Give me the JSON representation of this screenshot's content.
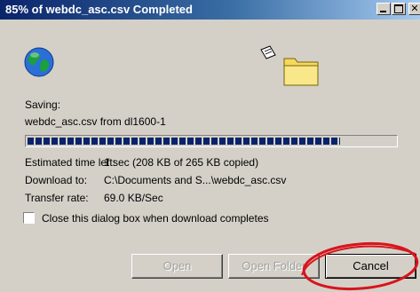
{
  "window": {
    "title": "85% of webdc_asc.csv Completed"
  },
  "status": {
    "saving_label": "Saving:",
    "file_line": "webdc_asc.csv from dl1600-1",
    "progress_fraction": 0.85
  },
  "details": [
    {
      "label": "Estimated time left:",
      "value": "1 sec (208 KB of 265 KB copied)"
    },
    {
      "label": "Download to:",
      "value": "C:\\Documents and S...\\webdc_asc.csv"
    },
    {
      "label": "Transfer rate:",
      "value": "69.0 KB/Sec"
    }
  ],
  "options": {
    "close_on_complete_label": "Close this dialog box when download completes",
    "close_on_complete_checked": false
  },
  "buttons": {
    "open": "Open",
    "open_folder": "Open Folder",
    "cancel": "Cancel"
  },
  "colors": {
    "title_bar": "#0a246a",
    "progress": "#0a246a",
    "annotation": "#d8141c"
  },
  "icons": {
    "globe": "globe-icon",
    "paper": "document-icon",
    "folder": "folder-icon"
  }
}
